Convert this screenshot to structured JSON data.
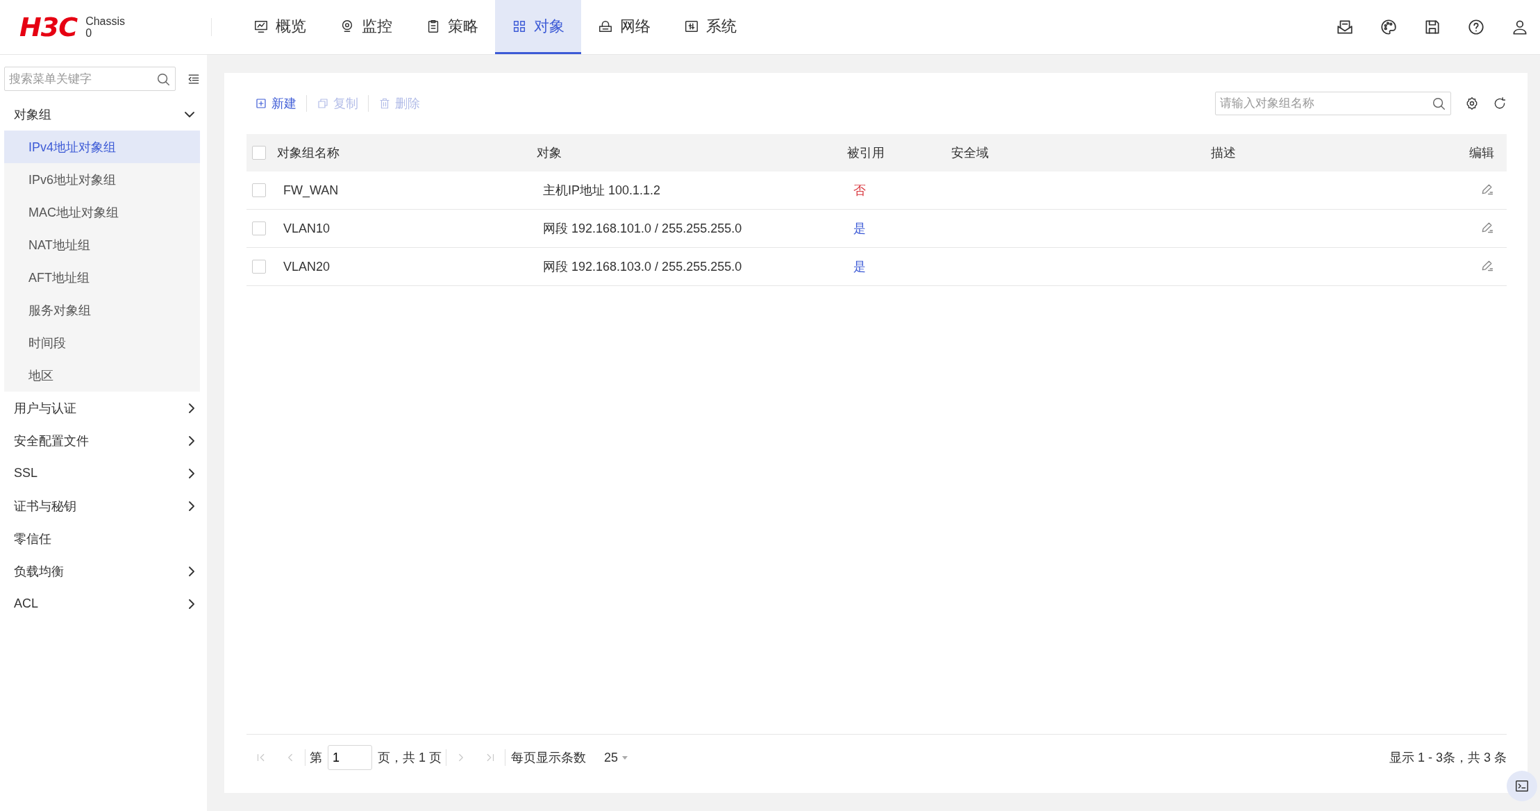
{
  "header": {
    "logo": "H3C",
    "device": "Chassis",
    "device_id": "0",
    "nav": [
      {
        "label": "概览",
        "selected": false
      },
      {
        "label": "监控",
        "selected": false
      },
      {
        "label": "策略",
        "selected": false
      },
      {
        "label": "对象",
        "selected": true
      },
      {
        "label": "网络",
        "selected": false
      },
      {
        "label": "系统",
        "selected": false
      }
    ]
  },
  "sidebar": {
    "search": {
      "placeholder": "搜索菜单关键字"
    },
    "items": [
      {
        "label": "对象组",
        "kind": "group",
        "expanded": true,
        "children": [
          {
            "label": "IPv4地址对象组",
            "selected": true
          },
          {
            "label": "IPv6地址对象组",
            "selected": false
          },
          {
            "label": "MAC地址对象组",
            "selected": false
          },
          {
            "label": "NAT地址组",
            "selected": false
          },
          {
            "label": "AFT地址组",
            "selected": false
          },
          {
            "label": "服务对象组",
            "selected": false
          },
          {
            "label": "时间段",
            "selected": false
          },
          {
            "label": "地区",
            "selected": false
          }
        ]
      },
      {
        "label": "用户与认证",
        "kind": "group",
        "expanded": false
      },
      {
        "label": "安全配置文件",
        "kind": "group",
        "expanded": false
      },
      {
        "label": "SSL",
        "kind": "group",
        "expanded": false
      },
      {
        "label": "证书与秘钥",
        "kind": "group",
        "expanded": false
      },
      {
        "label": "零信任",
        "kind": "leaf"
      },
      {
        "label": "负载均衡",
        "kind": "group",
        "expanded": false
      },
      {
        "label": "ACL",
        "kind": "group",
        "expanded": false
      }
    ]
  },
  "toolbar": {
    "buttons": [
      {
        "label": "新建",
        "disabled": false
      },
      {
        "label": "复制",
        "disabled": true
      },
      {
        "label": "删除",
        "disabled": true
      }
    ],
    "search": {
      "placeholder": "请输入对象组名称"
    }
  },
  "table": {
    "columns": [
      "对象组名称",
      "对象",
      "被引用",
      "安全域",
      "描述",
      "编辑"
    ],
    "header_checked": false,
    "rows": [
      {
        "checked": false,
        "name": "FW_WAN",
        "object": "主机IP地址 100.1.1.2",
        "referenced": "否",
        "referenced_state": false
      },
      {
        "checked": false,
        "name": "VLAN10",
        "object": "网段 192.168.101.0 / 255.255.255.0",
        "referenced": "是",
        "referenced_state": true
      },
      {
        "checked": false,
        "name": "VLAN20",
        "object": "网段 192.168.103.0 / 255.255.255.0",
        "referenced": "是",
        "referenced_state": true
      }
    ]
  },
  "pagination": {
    "page_prefix": "第",
    "page": "1",
    "page_suffix": "页，共 1 页",
    "page_size_label": "每页显示条数",
    "page_size": "25",
    "summary": "显示 1 - 3条，共 3 条",
    "first_disabled": true,
    "prev_disabled": true,
    "next_disabled": true,
    "last_disabled": true
  }
}
